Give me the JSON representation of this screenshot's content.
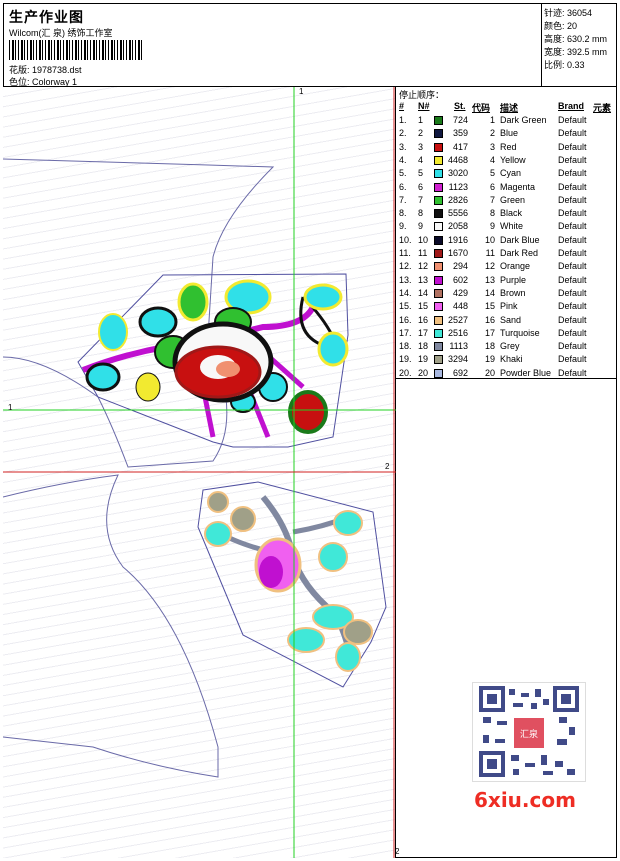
{
  "header": {
    "title": "生产作业图",
    "company": "Wilcom(汇 泉) 绣饰工作室",
    "design_label": "花版: 1978738.dst",
    "colorway_label": "色位: Colorway 1"
  },
  "stats": {
    "stitches": "针迹: 36054",
    "colors": "颜色: 20",
    "height": "高度: 630.2 mm",
    "width": "宽度: 392.5 mm",
    "scale": "比例: 0.33"
  },
  "legend": {
    "title": "停止顺序：",
    "headers": [
      "#",
      "N#",
      "St.",
      "代码",
      "描述",
      "Brand",
      "元素"
    ],
    "rows": [
      {
        "n": "1.",
        "nn": "1",
        "st": "724",
        "code": "1",
        "desc": "Dark Green",
        "brand": "Default",
        "color": "#1a7a1a"
      },
      {
        "n": "2.",
        "nn": "2",
        "st": "359",
        "code": "2",
        "desc": "Blue",
        "brand": "Default",
        "color": "#101840"
      },
      {
        "n": "3.",
        "nn": "3",
        "st": "417",
        "code": "3",
        "desc": "Red",
        "brand": "Default",
        "color": "#c81010"
      },
      {
        "n": "4.",
        "nn": "4",
        "st": "4468",
        "code": "4",
        "desc": "Yellow",
        "brand": "Default",
        "color": "#f2ea30"
      },
      {
        "n": "5.",
        "nn": "5",
        "st": "3020",
        "code": "5",
        "desc": "Cyan",
        "brand": "Default",
        "color": "#30e0e8"
      },
      {
        "n": "6.",
        "nn": "6",
        "st": "1123",
        "code": "6",
        "desc": "Magenta",
        "brand": "Default",
        "color": "#d020d0"
      },
      {
        "n": "7.",
        "nn": "7",
        "st": "2826",
        "code": "7",
        "desc": "Green",
        "brand": "Default",
        "color": "#30c030"
      },
      {
        "n": "8.",
        "nn": "8",
        "st": "5556",
        "code": "8",
        "desc": "Black",
        "brand": "Default",
        "color": "#101010"
      },
      {
        "n": "9.",
        "nn": "9",
        "st": "2058",
        "code": "9",
        "desc": "White",
        "brand": "Default",
        "color": "#f8f8f8"
      },
      {
        "n": "10.",
        "nn": "10",
        "st": "1916",
        "code": "10",
        "desc": "Dark Blue",
        "brand": "Default",
        "color": "#0a0a28"
      },
      {
        "n": "11.",
        "nn": "11",
        "st": "1670",
        "code": "11",
        "desc": "Dark Red",
        "brand": "Default",
        "color": "#a01818"
      },
      {
        "n": "12.",
        "nn": "12",
        "st": "294",
        "code": "12",
        "desc": "Orange",
        "brand": "Default",
        "color": "#f09070"
      },
      {
        "n": "13.",
        "nn": "13",
        "st": "602",
        "code": "13",
        "desc": "Purple",
        "brand": "Default",
        "color": "#c010d0"
      },
      {
        "n": "14.",
        "nn": "14",
        "st": "429",
        "code": "14",
        "desc": "Brown",
        "brand": "Default",
        "color": "#b07060"
      },
      {
        "n": "15.",
        "nn": "15",
        "st": "448",
        "code": "15",
        "desc": "Pink",
        "brand": "Default",
        "color": "#f060f0"
      },
      {
        "n": "16.",
        "nn": "16",
        "st": "2527",
        "code": "16",
        "desc": "Sand",
        "brand": "Default",
        "color": "#f0c080"
      },
      {
        "n": "17.",
        "nn": "17",
        "st": "2516",
        "code": "17",
        "desc": "Turquoise",
        "brand": "Default",
        "color": "#40e8d8"
      },
      {
        "n": "18.",
        "nn": "18",
        "st": "1113",
        "code": "18",
        "desc": "Grey",
        "brand": "Default",
        "color": "#8088a0"
      },
      {
        "n": "19.",
        "nn": "19",
        "st": "3294",
        "code": "19",
        "desc": "Khaki",
        "brand": "Default",
        "color": "#a0a088"
      },
      {
        "n": "20.",
        "nn": "20",
        "st": "692",
        "code": "20",
        "desc": "Powder Blue",
        "brand": "Default",
        "color": "#a8b8e0"
      }
    ]
  },
  "canvas": {
    "v_line_label": "1",
    "h_line_label": "1",
    "red_h_label": "2",
    "red_v_label": "2"
  },
  "watermark": {
    "site": "6xiu.com",
    "qr_badge": "汇泉"
  }
}
